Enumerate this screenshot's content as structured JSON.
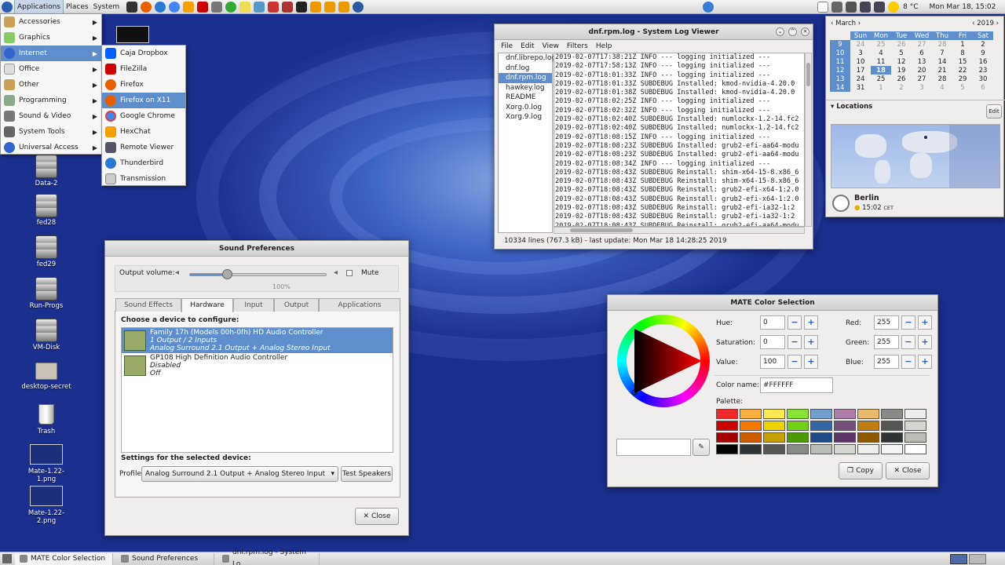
{
  "topbar": {
    "menus": [
      "Applications",
      "Places",
      "System"
    ],
    "temp": "8 °C",
    "clock": "Mon Mar 18, 15:02"
  },
  "taskbar": {
    "tasks": [
      "MATE Color Selection",
      "Sound Preferences",
      "dnf.rpm.log - System Lo..."
    ]
  },
  "desktop": {
    "icons": [
      "Data-2",
      "fed28",
      "fed29",
      "Run-Progs",
      "VM-Disk",
      "desktop-secret",
      "Trash",
      "Mate-1.22-1.png",
      "Mate-1.22-2.png"
    ]
  },
  "app_menu": {
    "items": [
      "Accessories",
      "Graphics",
      "Internet",
      "Office",
      "Other",
      "Programming",
      "Sound & Video",
      "System Tools",
      "Universal Access"
    ],
    "internet_items": [
      "Caja Dropbox",
      "FileZilla",
      "Firefox",
      "Firefox on X11",
      "Google Chrome",
      "HexChat",
      "Remote Viewer",
      "Thunderbird",
      "Transmission"
    ]
  },
  "log_viewer": {
    "title": "dnf.rpm.log - System Log Viewer",
    "menus": [
      "File",
      "Edit",
      "View",
      "Filters",
      "Help"
    ],
    "files": [
      "dnf.librepo.log",
      "dnf.log",
      "dnf.rpm.log",
      "hawkey.log",
      "README",
      "Xorg.0.log",
      "Xorg.9.log"
    ],
    "lines": [
      "2019-02-07T17:38:21Z INFO --- logging initialized ---",
      "2019-02-07T17:58:13Z INFO --- logging initialized ---",
      "2019-02-07T18:01:33Z INFO --- logging initialized ---",
      "2019-02-07T18:01:33Z SUBDEBUG Installed: kmod-nvidia-4.20.0",
      "2019-02-07T18:01:38Z SUBDEBUG Installed: kmod-nvidia-4.20.0",
      "2019-02-07T18:02:25Z INFO --- logging initialized ---",
      "2019-02-07T18:02:32Z INFO --- logging initialized ---",
      "2019-02-07T18:02:40Z SUBDEBUG Installed: numlockx-1.2-14.fc2",
      "2019-02-07T18:02:40Z SUBDEBUG Installed: numlockx-1.2-14.fc2",
      "2019-02-07T18:08:15Z INFO --- logging initialized ---",
      "2019-02-07T18:08:23Z SUBDEBUG Installed: grub2-efi-aa64-modu",
      "2019-02-07T18:08:23Z SUBDEBUG Installed: grub2-efi-aa64-modu",
      "2019-02-07T18:08:34Z INFO --- logging initialized ---",
      "2019-02-07T18:08:43Z SUBDEBUG Reinstall: shim-x64-15-8.x86_6",
      "2019-02-07T18:08:43Z SUBDEBUG Reinstall: shim-x64-15-8.x86_6",
      "2019-02-07T18:08:43Z SUBDEBUG Reinstall: grub2-efi-x64-1:2.0",
      "2019-02-07T18:08:43Z SUBDEBUG Reinstall: grub2-efi-x64-1:2.0",
      "2019-02-07T18:08:43Z SUBDEBUG Reinstall: grub2-efi-ia32-1:2",
      "2019-02-07T18:08:43Z SUBDEBUG Reinstall: grub2-efi-ia32-1:2",
      "2019-02-07T18:08:43Z SUBDEBUG Reinstall: grub2-efi-aa64-modu"
    ],
    "status": "10334 lines (767.3 kB) - last update: Mon Mar 18 14:28:25 2019"
  },
  "sound": {
    "title": "Sound Preferences",
    "output_volume_label": "Output volume:",
    "mute_label": "Mute",
    "percent": "100%",
    "volume_fraction": 0.27,
    "tabs": [
      "Sound Effects",
      "Hardware",
      "Input",
      "Output",
      "Applications"
    ],
    "choose_label": "Choose a device to configure:",
    "devices": [
      {
        "name": "Family 17h (Models 00h-0fh) HD Audio Controller",
        "line2": "1 Output / 2 Inputs",
        "line3": "Analog Surround 2.1 Output + Analog Stereo Input"
      },
      {
        "name": "GP108 High Definition Audio Controller",
        "line2": "Disabled",
        "line3": "Off"
      }
    ],
    "settings_label": "Settings for the selected device:",
    "profile_label": "Profile:",
    "profile_value": "Analog Surround 2.1 Output + Analog Stereo Input",
    "test_speakers": "Test Speakers",
    "close": "Close"
  },
  "color": {
    "title": "MATE Color Selection",
    "hue_label": "Hue:",
    "hue": "0",
    "sat_label": "Saturation:",
    "sat": "0",
    "val_label": "Value:",
    "val": "100",
    "red_label": "Red:",
    "red": "255",
    "green_label": "Green:",
    "green": "255",
    "blue_label": "Blue:",
    "blue": "255",
    "name_label": "Color name:",
    "name": "#FFFFFF",
    "palette_label": "Palette:",
    "copy": "Copy",
    "close": "Close",
    "palette": [
      "#ef2929",
      "#fcaf3e",
      "#fce94f",
      "#8ae234",
      "#729fcf",
      "#ad7fa8",
      "#e9b96e",
      "#888a85",
      "#eeeeec",
      "#cc0000",
      "#f57900",
      "#edd400",
      "#73d216",
      "#3465a4",
      "#75507b",
      "#c17d11",
      "#555753",
      "#d3d7cf",
      "#a40000",
      "#ce5c00",
      "#c4a000",
      "#4e9a06",
      "#204a87",
      "#5c3566",
      "#8f5902",
      "#2e3436",
      "#babdb6",
      "#000000",
      "#2e3436",
      "#555753",
      "#888a85",
      "#babdb6",
      "#d3d7cf",
      "#eeeeec",
      "#f3f3f3",
      "#ffffff"
    ]
  },
  "calendar": {
    "month": "March",
    "year": "2019",
    "days": [
      "Sun",
      "Mon",
      "Tue",
      "Wed",
      "Thu",
      "Fri",
      "Sat"
    ],
    "weeks": [
      {
        "wk": "9",
        "d": [
          "24",
          "25",
          "26",
          "27",
          "28",
          "1",
          "2"
        ]
      },
      {
        "wk": "10",
        "d": [
          "3",
          "4",
          "5",
          "6",
          "7",
          "8",
          "9"
        ]
      },
      {
        "wk": "11",
        "d": [
          "10",
          "11",
          "12",
          "13",
          "14",
          "15",
          "16"
        ]
      },
      {
        "wk": "12",
        "d": [
          "17",
          "18",
          "19",
          "20",
          "21",
          "22",
          "23"
        ]
      },
      {
        "wk": "13",
        "d": [
          "24",
          "25",
          "26",
          "27",
          "28",
          "29",
          "30"
        ]
      },
      {
        "wk": "14",
        "d": [
          "31",
          "1",
          "2",
          "3",
          "4",
          "5",
          "6"
        ]
      }
    ],
    "locations_label": "Locations",
    "edit": "Edit",
    "city": "Berlin",
    "city_time": "15:02",
    "tz": "CET"
  }
}
